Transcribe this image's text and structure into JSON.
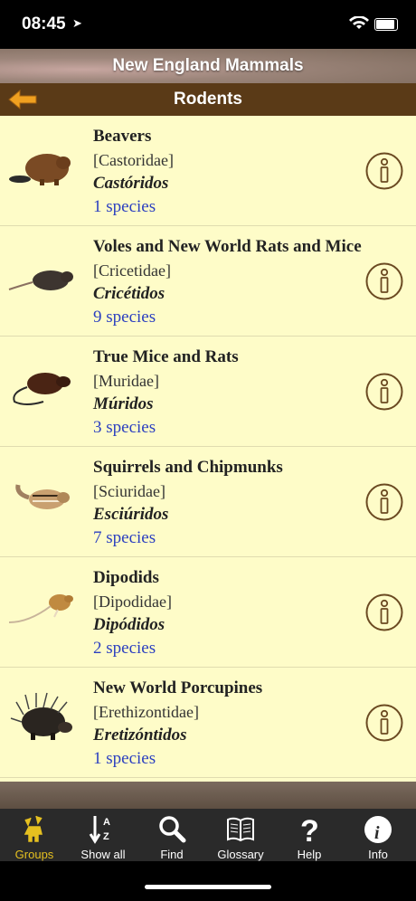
{
  "status": {
    "time": "08:45"
  },
  "header": {
    "title": "New England Mammals",
    "subtitle": "Rodents"
  },
  "rows": [
    {
      "name": "Beavers",
      "family": "[Castoridae]",
      "spanish": "Castóridos",
      "count": "1 species",
      "icon": "beaver-icon"
    },
    {
      "name": "Voles and New World Rats and Mice",
      "family": "[Cricetidae]",
      "spanish": "Cricétidos",
      "count": "9 species",
      "icon": "vole-icon"
    },
    {
      "name": "True Mice and Rats",
      "family": "[Muridae]",
      "spanish": "Múridos",
      "count": "3 species",
      "icon": "rat-icon"
    },
    {
      "name": "Squirrels and Chipmunks",
      "family": "[Sciuridae]",
      "spanish": "Esciúridos",
      "count": "7 species",
      "icon": "chipmunk-icon"
    },
    {
      "name": "Dipodids",
      "family": "[Dipodidae]",
      "spanish": "Dipódidos",
      "count": "2 species",
      "icon": "jumping-mouse-icon"
    },
    {
      "name": "New World Porcupines",
      "family": "[Erethizontidae]",
      "spanish": "Eretizóntidos",
      "count": "1 species",
      "icon": "porcupine-icon"
    }
  ],
  "tabs": [
    {
      "label": "Groups",
      "icon": "groups-icon",
      "active": true
    },
    {
      "label": "Show all",
      "icon": "sort-az-icon"
    },
    {
      "label": "Find",
      "icon": "search-icon"
    },
    {
      "label": "Glossary",
      "icon": "book-icon"
    },
    {
      "label": "Help",
      "icon": "question-icon"
    },
    {
      "label": "Info",
      "icon": "info-icon"
    }
  ],
  "colors": {
    "list_bg": "#fefcc8",
    "subbar": "#5a3a17",
    "info_ring": "#6b4a22",
    "count_link": "#2b3fc0",
    "active_tab": "#e5c020"
  }
}
